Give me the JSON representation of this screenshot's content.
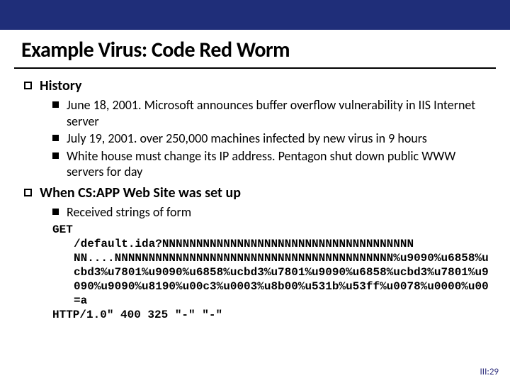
{
  "title": "Example Virus: Code Red Worm",
  "sections": [
    {
      "heading": "History",
      "items": [
        "June 18, 2001.  Microsoft announces buffer overflow vulnerability in IIS Internet server",
        "July 19, 2001. over 250,000 machines infected by new virus in 9 hours",
        "White house must change its IP address.  Pentagon shut down public WWW servers for day"
      ]
    },
    {
      "heading": "When CS:APP Web Site was set up",
      "items": [
        "Received strings of form"
      ]
    }
  ],
  "code": {
    "line1": "GET",
    "line2": "/default.ida?NNNNNNNNNNNNNNNNNNNNNNNNNNNNNNNNNNNNN",
    "line3": "NN....NNNNNNNNNNNNNNNNNNNNNNNNNNNNNNNNNNNNNNNNN%u9090%u6858%ucbd3%u7801%u9090%u6858%ucbd3%u7801%u9090%u6858%ucbd3%u7801%u9090%u9090%u8190%u00c3%u0003%u8b00%u531b%u53ff%u0078%u0000%u00=a",
    "line4": "HTTP/1.0\" 400 325 \"-\" \"-\""
  },
  "footer": "III:29"
}
